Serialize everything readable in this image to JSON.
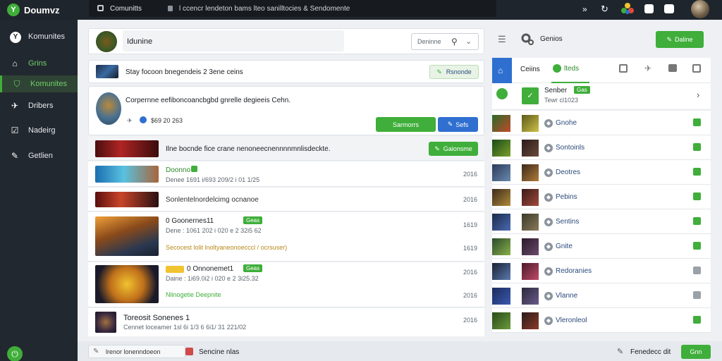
{
  "app": {
    "name": "Doumvz"
  },
  "topbar": {
    "tab_label": "Comunitts",
    "address_text": "l ccencr lendeton bams lteo sanilltocies & Sendomente",
    "icons": [
      "chevrons-right-icon",
      "refresh-icon",
      "colorful-game-icon",
      "brand-icon",
      "camera-icon"
    ]
  },
  "sidebar": {
    "items": [
      {
        "label": "Komunites",
        "icon": "logo-icon"
      },
      {
        "label": "Grins",
        "icon": "home-icon"
      },
      {
        "label": "Komunites",
        "icon": "shield-icon"
      },
      {
        "label": "Dribers",
        "icon": "share-icon"
      },
      {
        "label": "Nadeirg",
        "icon": "check-box-icon"
      },
      {
        "label": "Getlien",
        "icon": "pencil-icon"
      }
    ],
    "bottom_icon": "power-icon"
  },
  "header": {
    "title": "Idunine",
    "search_placeholder": "Deninne"
  },
  "post_bar": {
    "text": "Stay focoon bnegendeis 2 3ene ceins",
    "button_label": "Rsnonde"
  },
  "feature": {
    "text": "Corpernne eefiboncoancbgbd gnrelle degieeis Cehn.",
    "stats": "$69 20 263",
    "btn_green": "Sarmorrs",
    "btn_blue": "Sefs"
  },
  "banner_row": {
    "text": "Ilne bocnde fice crane nenoneecnennnnmnlisdeckte.",
    "button_label": "Gaionsme"
  },
  "feed": [
    {
      "title": "Doonno",
      "badge": "",
      "meta": "Denee 1691 i/693 209/2 i 01 1/25",
      "date": "2016",
      "extra": "",
      "thumb": "bluehero"
    },
    {
      "title": "",
      "badge": "",
      "meta": "",
      "date": "2016",
      "extra": "Sonlentelnordelcimg ocnanoe",
      "thumb": "redbanner"
    },
    {
      "title": "0 Goonernes11",
      "badge": "Geas",
      "meta": "Dene : 1061 202 i 020 e 2 32i5 62",
      "date": "1619",
      "extra": "Secocest lolit lnoltyaneonoecccl / ocrsuser)",
      "thumb": "warrior"
    },
    {
      "title": "0 Onnonemet1",
      "badge": "Geas",
      "meta": "Daine : 1i69.0i2 i 020 e 2 3i25.32",
      "date": "2016",
      "extra": "Nlinogetie Deepnite",
      "thumb": "gold"
    },
    {
      "title": "Toreosit Sonenes 1",
      "badge": "",
      "meta": "Cennet loceamer 1sl 6i 1/3 6 6i1/ 31 221/02",
      "date": "2016",
      "extra": "",
      "thumb": "dark"
    }
  ],
  "right_panel": {
    "header_label": "Genios",
    "button_label": "Daline",
    "tabs": {
      "tab1": "Ceiins",
      "tab2": "lteds"
    },
    "profile": {
      "name": "Senber",
      "badge": "Gas",
      "meta": "Tewr cl1023"
    },
    "list": [
      "Gnohe",
      "Sontoinls",
      "Deotres",
      "Pebins",
      "Sentins",
      "Gnite",
      "Redoranies",
      "Vlanne",
      "Vleronleol"
    ]
  },
  "bottombar": {
    "left_text": "lrenor lonenndoeon",
    "mid_text": "Sencine nlas",
    "right_text": "Fenedecc dit",
    "button_label": "Gnn"
  }
}
